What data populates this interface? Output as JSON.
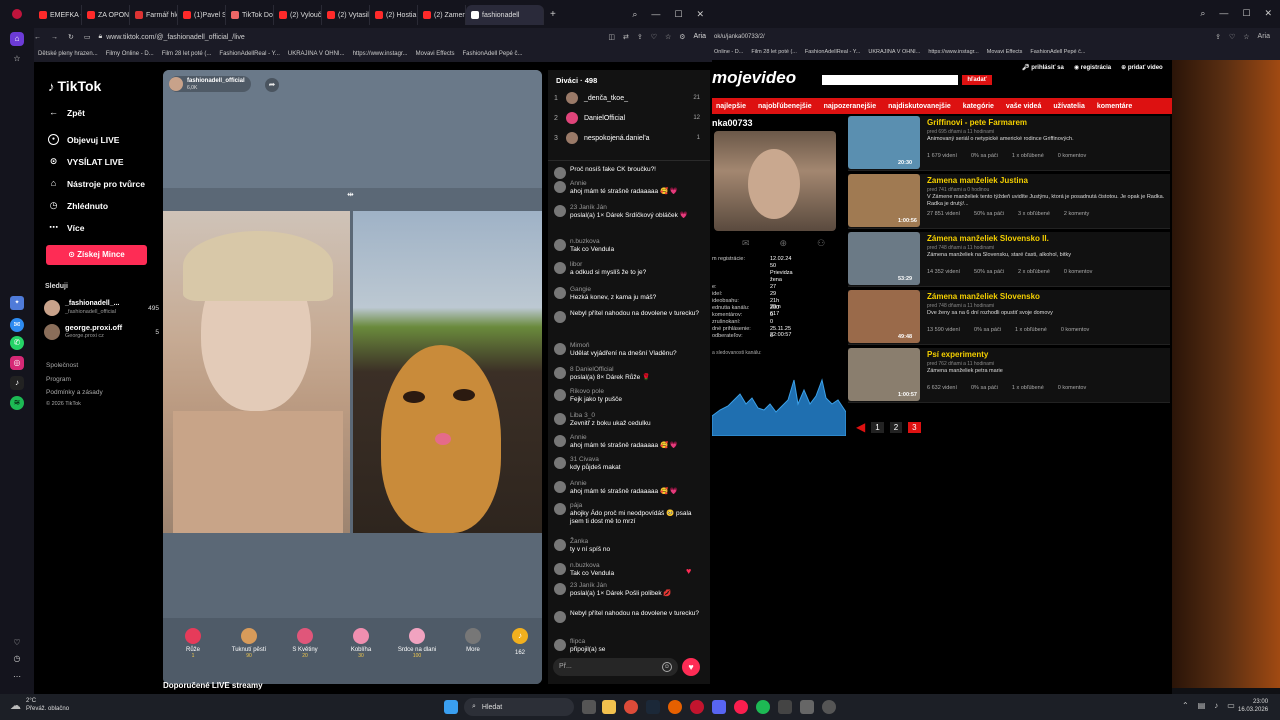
{
  "left_browser": {
    "tabs": [
      {
        "label": "EMEFKA - You",
        "color": "#ff2a2a"
      },
      {
        "label": "ZA OPONOU",
        "color": "#ff2a2a"
      },
      {
        "label": "Farmář hledá",
        "color": "#d33"
      },
      {
        "label": "(1)Pavel Skokl",
        "color": "#ff2a2a"
      },
      {
        "label": "TikTok Downl",
        "color": "#e66"
      },
      {
        "label": "(2) Vyloučeni",
        "color": "#ff2a2a"
      },
      {
        "label": "(2) Vytasil vid",
        "color": "#ff2a2a"
      },
      {
        "label": "(2) Hostia ne",
        "color": "#ff2a2a"
      },
      {
        "label": "(2) Zamena m",
        "color": "#ff2a2a"
      },
      {
        "label": "fashionadell",
        "color": "#ffffff"
      }
    ],
    "url": "www.tiktok.com/@_fashionadell_official_/live",
    "bookmarks": [
      "Dětské pleny hrazen...",
      "Filmy Online - D...",
      "Film 28 let poté (...",
      "FashionAdellReal - Y...",
      "UKRAJINA V OHNI...",
      "https://www.instagr...",
      "Movavi Effects",
      "FashionAdell Pepé č..."
    ]
  },
  "tiktok": {
    "logo": "TikTok",
    "nav": [
      {
        "label": "Zpět",
        "icon": "arrow-left"
      },
      {
        "label": "Objevuj LIVE",
        "icon": "live"
      },
      {
        "label": "VYSÍLAT LIVE",
        "icon": "broadcast"
      },
      {
        "label": "Nástroje pro tvůrce",
        "icon": "home"
      },
      {
        "label": "Zhlédnuto",
        "icon": "clock"
      },
      {
        "label": "Více",
        "icon": "dots"
      }
    ],
    "coins_button": "Získej Mince",
    "following_label": "Sleduji",
    "following": [
      {
        "name": "_fashionadell_...",
        "sub": "_fashionadell_official",
        "count": "495"
      },
      {
        "name": "george.proxi.off",
        "sub": "George.proxi cz",
        "count": "5"
      }
    ],
    "footer": [
      "Společnost",
      "Program",
      "Podmínky a zásady",
      "© 2026 TikTok"
    ],
    "host": "fashionadell_official",
    "host_likes": "6,0K",
    "recommended": "Doporučené LIVE streamy",
    "gifts": [
      {
        "name": "Růže",
        "cost": "1",
        "color": "#e63b5a"
      },
      {
        "name": "Tuknutí pěstí",
        "cost": "90",
        "color": "#d89b5a"
      },
      {
        "name": "S Květiny",
        "cost": "20",
        "color": "#e0567a"
      },
      {
        "name": "Koblíha",
        "cost": "30",
        "color": "#f08fb0"
      },
      {
        "name": "Srdce na dlani",
        "cost": "100",
        "color": "#f1a3c0"
      },
      {
        "name": "More",
        "cost": "",
        "color": "#777"
      }
    ],
    "balance": "162"
  },
  "chat": {
    "viewers_label": "Diváci · 498",
    "top_viewers": [
      {
        "rank": "1",
        "name": "_denča_tkoe_",
        "score": "21"
      },
      {
        "rank": "2",
        "name": "DanielOfficial",
        "score": "12"
      },
      {
        "rank": "3",
        "name": "nespokojená.daniel'a",
        "score": "1"
      }
    ],
    "messages": [
      {
        "user": "",
        "text": "Proč nosíš fake CK broučku?!"
      },
      {
        "user": "Annie",
        "text": "ahoj mám té strašně radaaaaa 🥰 💗"
      },
      {
        "user": "23 Janík Ján",
        "text": "poslal(a) 1× Dárek Srdíčkový obláček 💗"
      },
      {
        "user": "n.buzkova",
        "text": "Tak co Vendula"
      },
      {
        "user": "libor",
        "text": "a odkud si myslíš že to je?"
      },
      {
        "user": "Gangie",
        "text": "Hezká konev, z kama ju máš?"
      },
      {
        "user": "",
        "text": "Nebyl přítel nahodou na dovolene v turecku?"
      },
      {
        "user": "Mimoň",
        "text": "Udělat vyjádření na dnešní Vladěnu?"
      },
      {
        "user": "8 DanielOfficial",
        "text": "poslal(a) 8× Dárek Růže 🌹"
      },
      {
        "user": "Rikovo pole",
        "text": "Fejk jako ty pušče"
      },
      {
        "user": "Liba 3_0",
        "text": "Zevnitř z boku ukaž cedulku"
      },
      {
        "user": "Annie",
        "text": "ahoj mám té strašně radaaaaa 🥰 💗"
      },
      {
        "user": "31 Civava",
        "text": "kdy půjdeš makat"
      },
      {
        "user": "Annie",
        "text": "ahoj mám té strašně radaaaaa 🥰 💗"
      },
      {
        "user": "pája",
        "text": "ahojky Ádo proč mi neodpovídáš 🥺 psala jsem ti dost mě to mrzí"
      },
      {
        "user": "Žanka",
        "text": "ty v ní spíš no"
      },
      {
        "user": "n.buzkova",
        "text": "Tak co Vendula"
      },
      {
        "user": "23 Janík Ján",
        "text": "poslal(a) 1× Dárek Pošli polibek 💋"
      },
      {
        "user": "",
        "text": "Nebyl přítel nahodou na dovolene v turecku?"
      },
      {
        "user": "flipca",
        "text": "připojil(a) se"
      }
    ],
    "input_placeholder": "Př..."
  },
  "right_browser": {
    "url": "ok/u/janka00733/2/",
    "bookmarks": [
      "Online - D...",
      "Film 28 let poté (...",
      "FashionAdellReal - Y...",
      "UKRAJINA V OHNI...",
      "https://www.instagr...",
      "Movavi Effects",
      "FashionAdell Pepé č..."
    ],
    "site_logo": "mojevideo",
    "search_button": "hľadať",
    "top_links": [
      "prihlásiť sa",
      "registrácia",
      "pridať video"
    ],
    "menu": [
      "najlepšie",
      "najobľúbenejšie",
      "najpozeranejšie",
      "najdiskutovanejšie",
      "kategórie",
      "vaše videá",
      "užívatelia",
      "komentáre"
    ],
    "username": "nka00733",
    "profile": [
      {
        "k": "m registrácie:",
        "v": "12.02.24"
      },
      {
        "k": "",
        "v": "50"
      },
      {
        "k": "",
        "v": "Prievidza"
      },
      {
        "k": "",
        "v": "žena"
      },
      {
        "k": "e:",
        "v": "27"
      },
      {
        "k": "ideí:",
        "v": "29"
      },
      {
        "k": "ideobsahu:",
        "v": "21h 29m"
      },
      {
        "k": "ednutia kanálu:",
        "v": "200 617"
      },
      {
        "k": "komentárov:",
        "v": "0"
      },
      {
        "k": "zrušnokaní:",
        "v": "0"
      },
      {
        "k": "dné prihlásenie:",
        "v": "25.11.25 22:00:57"
      },
      {
        "k": "odberateľov:",
        "v": "0"
      }
    ],
    "graph_label": "a sledovanosti kanálu:",
    "videos": [
      {
        "title": "Griffinovi - pete Farmarem",
        "meta": "pred 695 dňami a 11 hodinami",
        "desc": "Animovaný seriál o netypické americké rodince Griffinových.",
        "views": "1 679 videní",
        "likes": "0% sa páči",
        "fav": "1 x obľúbené",
        "comments": "0 komentov",
        "dur": "20:30",
        "color": "#5a8fb0"
      },
      {
        "title": "Zamena manželiek Justina",
        "meta": "pred 741 dňami a 0 hodinou",
        "desc": "V Zámene manželiek tento týždeň uvidíte Justýnu, ktorá je posadnutá čistotou. Je opak je Radka. Radka je drutý/...",
        "views": "27 851 videní",
        "likes": "50% sa páči",
        "fav": "3 x obľúbené",
        "comments": "2 komenty",
        "dur": "1:00:56",
        "color": "#a07a52"
      },
      {
        "title": "Zámena manželiek Slovensko II.",
        "meta": "pred 748 dňami a 11 hodinami",
        "desc": "Zámena manželiek na Slovensku, staré časti, alkohol, bitky",
        "views": "14 352 videní",
        "likes": "50% sa páči",
        "fav": "2 x obľúbené",
        "comments": "0 komentov",
        "dur": "53:29",
        "color": "#6b7a86"
      },
      {
        "title": "Zámena manželiek Slovensko",
        "meta": "pred 748 dňami a 11 hodinami",
        "desc": "Dve ženy sa na 6 dní rozhodli opustiť svoje domovy",
        "views": "13 590 videní",
        "likes": "0% sa páči",
        "fav": "1 x obľúbené",
        "comments": "0 komentov",
        "dur": "49:48",
        "color": "#9a6a4a"
      },
      {
        "title": "Psí experimenty",
        "meta": "pred 762 dňami a 11 hodinami",
        "desc": "Zámena manželiek petra marie",
        "views": "6 632 videní",
        "likes": "0% sa páči",
        "fav": "1 x obľúbené",
        "comments": "0 komentov",
        "dur": "1:00:57",
        "color": "#8a7e6e"
      }
    ],
    "pages": [
      "1",
      "2",
      "3"
    ]
  },
  "taskbar": {
    "weather_temp": "2°C",
    "weather_desc": "Převáž. oblačno",
    "search": "Hledat",
    "time": "23:00",
    "date": "16.03.2026"
  }
}
